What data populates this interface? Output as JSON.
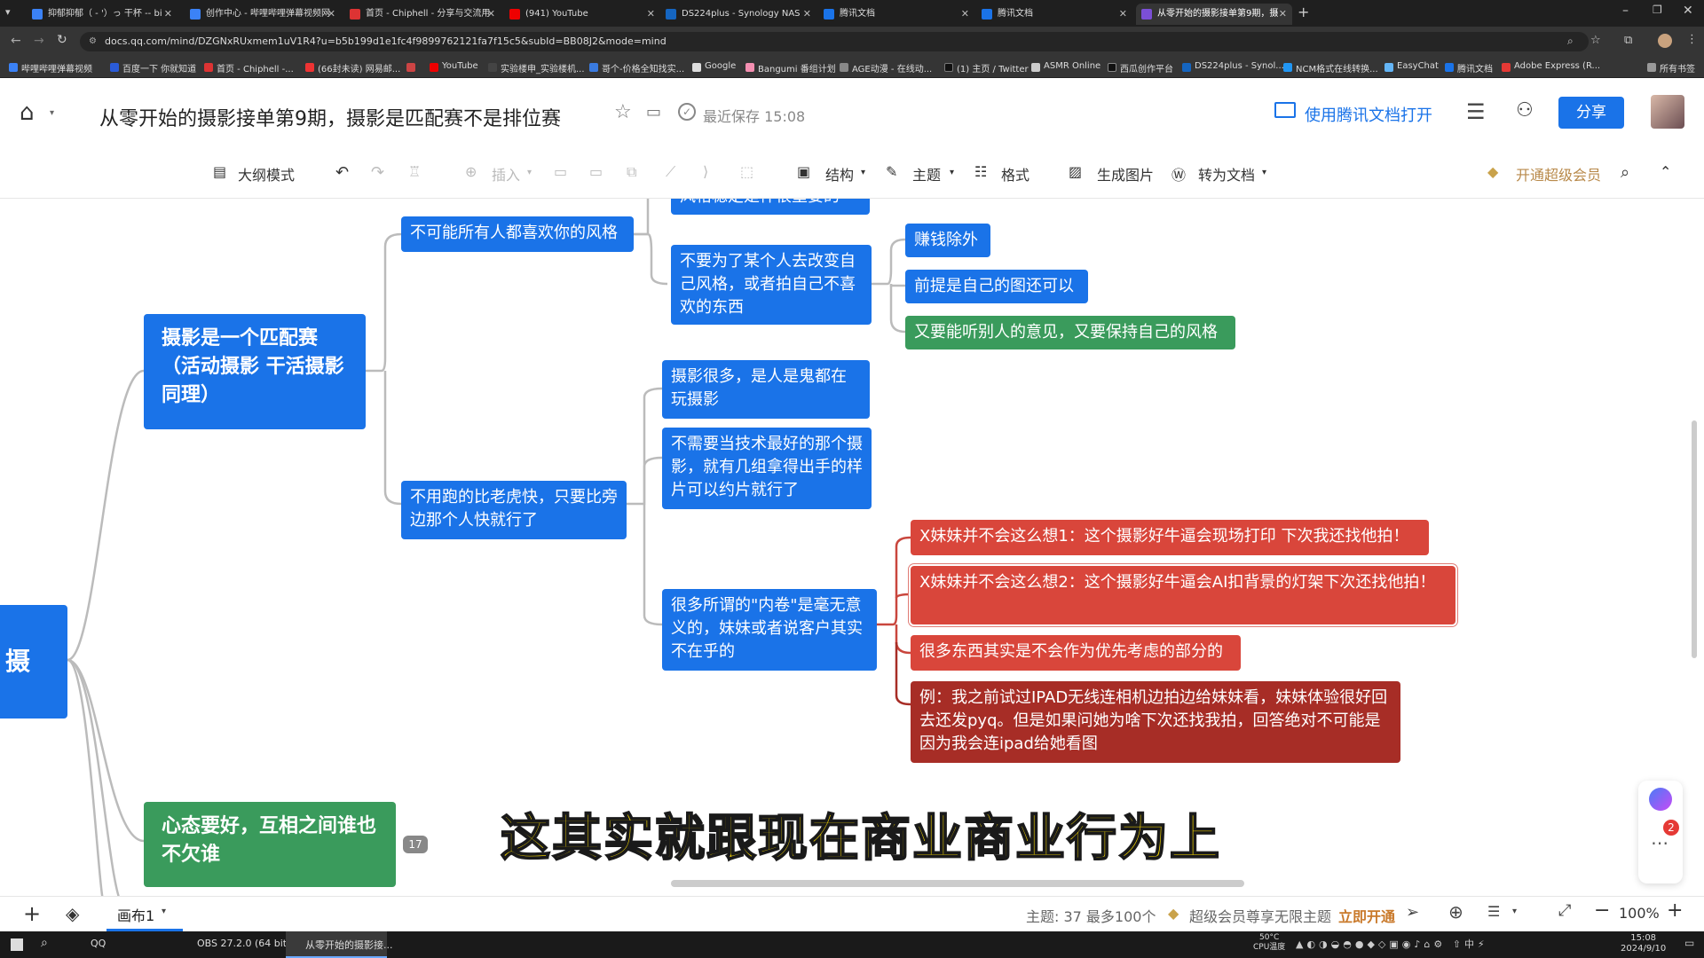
{
  "browser": {
    "tabs": [
      {
        "label": "抑郁抑郁（ - '）っ 干杯 -- bi",
        "color": "#3b82f6"
      },
      {
        "label": "创作中心 - 哔哩哔哩弹幕视频网",
        "color": "#3b82f6"
      },
      {
        "label": "首页 - Chiphell - 分享与交流用",
        "color": "#d33"
      },
      {
        "label": "(941) YouTube",
        "color": "#e00"
      },
      {
        "label": "DS224plus - Synology NAS",
        "color": "#1565c0"
      },
      {
        "label": "腾讯文档",
        "color": "#1a73e8"
      },
      {
        "label": "腾讯文档",
        "color": "#1a73e8"
      },
      {
        "label": "从零开始的摄影接单第9期，摄",
        "color": "#7b4fd6"
      }
    ],
    "url": "docs.qq.com/mind/DZGNxRUxmem1uV1R4?u=b5b199d1e1fc4f9899762121fa7f15c5&subId=BB08J2&mode=mind",
    "bookmarks": [
      "哔哩哔哩弹幕视频",
      "百度一下 你就知道",
      "首页 - Chiphell -...",
      "(66封未读) 网易邮...",
      "",
      "YouTube",
      "实验楼申_实验楼机...",
      "哥个-价格全知找实...",
      "Google",
      "Bangumi 番组计划",
      "AGE动漫 - 在线动...",
      "(1) 主页 / Twitter",
      "ASMR Online",
      "西瓜创作平台",
      "DS224plus - Synol...",
      "NCM格式在线转换...",
      "EasyChat",
      "腾讯文档",
      "Adobe Express (R..."
    ],
    "bookmarks_folder": "所有书签"
  },
  "doc": {
    "title": "从零开始的摄影接单第9期，摄影是匹配赛不是排位赛",
    "save_status": "最近保存 15:08",
    "open_in_app": "使用腾讯文档打开",
    "share": "分享"
  },
  "toolbar": {
    "outline": "大纲模式",
    "insert": "插入",
    "structure": "结构",
    "theme": "主题",
    "format": "格式",
    "gen_image": "生成图片",
    "to_doc": "转为文档",
    "vip": "开通超级会员"
  },
  "mindmap": {
    "root": "摄",
    "main_node": "摄影是一个匹配赛（活动摄影 干活摄影同理）",
    "green_main": "心态要好，互相之间谁也不欠谁",
    "collapsed_count": "17",
    "branch1": "不可能所有人都喜欢你的风格",
    "branch1_top": "风格稳定是件很重要的",
    "branch1_child": "不要为了某个人去改变自己风格，或者拍自己不喜欢的东西",
    "leaf_earn": "赚钱除外",
    "leaf_premise": "前提是自己的图还可以",
    "leaf_balance": "又要能听别人的意见，又要保持自己的风格",
    "branch2": "不用跑的比老虎快，只要比旁边那个人快就行了",
    "b2_c1": "摄影很多，是人是鬼都在玩摄影",
    "b2_c2": "不需要当技术最好的那个摄影，就有几组拿得出手的样片可以约片就行了",
    "b2_c3": "很多所谓的\"内卷\"是毫无意义的，妹妹或者说客户其实不在乎的",
    "r1": "X妹妹并不会这么想1：这个摄影好牛逼会现场打印 下次我还找他拍！",
    "r2": "X妹妹并不会这么想2：这个摄影好牛逼会AI扣背景的灯架下次还找他拍！",
    "r3": "很多东西其实是不会作为优先考虑的部分的",
    "r4": "例：我之前试过IPAD无线连相机边拍边给妹妹看，妹妹体验很好回去还发pyq。但是如果问她为啥下次还找我拍，回答绝对不可能是因为我会连ipad给她看图"
  },
  "subtitle": "这其实就跟现在商业商业行为上",
  "bottom": {
    "canvas_tab": "画布1",
    "topic_count": "主题: 37 最多100个",
    "vip_promo": "超级会员尊享无限主题",
    "vip_open": "立即开通",
    "zoom": "100%",
    "badge": "2"
  },
  "taskbar": {
    "apps": [
      "QQ",
      "OBS 27.2.0 (64 bit...",
      "从零开始的摄影接..."
    ],
    "temp": "50°C",
    "temp_label": "CPU温度",
    "time": "15:08",
    "date": "2024/9/10"
  },
  "colors": {
    "blue": "#1a73e8",
    "green": "#3a9b5c",
    "red": "#d9463b",
    "dark_red": "#a72d26",
    "subtitle": "#ffe000"
  }
}
